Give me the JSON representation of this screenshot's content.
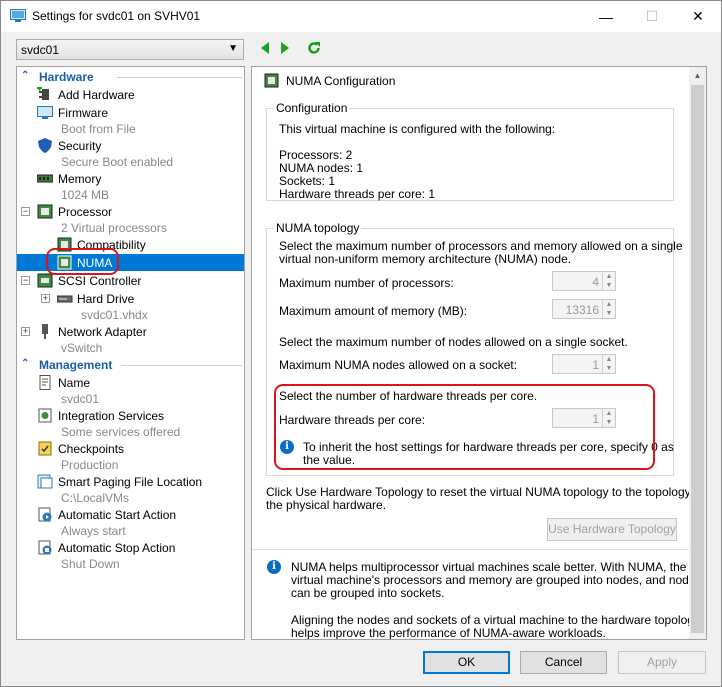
{
  "window": {
    "title": "Settings for svdc01 on SVHV01",
    "minimize": "—",
    "maximize": "☐",
    "close": "✕"
  },
  "vm_selector": {
    "value": "svdc01"
  },
  "tree": {
    "hardware_header": "Hardware",
    "management_header": "Management",
    "items": [
      {
        "label": "Add Hardware",
        "sub": ""
      },
      {
        "label": "Firmware",
        "sub": "Boot from File"
      },
      {
        "label": "Security",
        "sub": "Secure Boot enabled"
      },
      {
        "label": "Memory",
        "sub": "1024 MB"
      },
      {
        "label": "Processor",
        "sub": "2 Virtual processors"
      },
      {
        "label": "Compatibility",
        "sub": ""
      },
      {
        "label": "NUMA",
        "sub": ""
      },
      {
        "label": "SCSI Controller",
        "sub": ""
      },
      {
        "label": "Hard Drive",
        "sub": "svdc01.vhdx"
      },
      {
        "label": "Network Adapter",
        "sub": "vSwitch"
      },
      {
        "label": "Name",
        "sub": "svdc01"
      },
      {
        "label": "Integration Services",
        "sub": "Some services offered"
      },
      {
        "label": "Checkpoints",
        "sub": "Production"
      },
      {
        "label": "Smart Paging File Location",
        "sub": "C:\\LocalVMs"
      },
      {
        "label": "Automatic Start Action",
        "sub": "Always start"
      },
      {
        "label": "Automatic Stop Action",
        "sub": "Shut Down"
      }
    ]
  },
  "numa_panel": {
    "title": "NUMA Configuration",
    "config_group_title": "Configuration",
    "config_intro": "This virtual machine is configured with the following:",
    "config_lines": [
      "Processors: 2",
      "NUMA nodes: 1",
      "Sockets: 1",
      "Hardware threads per core: 1"
    ],
    "topology_group_title": "NUMA topology",
    "topology_desc_1": "Select the maximum number of processors and memory allowed on a single",
    "topology_desc_2": "virtual non-uniform memory architecture (NUMA) node.",
    "max_processors_label": "Maximum number of processors:",
    "max_processors_value": "4",
    "max_memory_label": "Maximum amount of memory (MB):",
    "max_memory_value": "13316",
    "nodes_desc": "Select the maximum number of nodes allowed on a single socket.",
    "max_nodes_label": "Maximum NUMA nodes allowed on a socket:",
    "max_nodes_value": "1",
    "threads_desc": "Select the number of hardware threads per core.",
    "threads_label": "Hardware threads per core:",
    "threads_value": "1",
    "threads_info_1": "To inherit the host settings for hardware threads per core, specify 0 as",
    "threads_info_2": "the value.",
    "reset_desc_1": "Click Use Hardware Topology to reset the virtual NUMA topology to the topology of",
    "reset_desc_2": "the physical hardware.",
    "use_hw_topology_button": "Use Hardware Topology",
    "info_1": "NUMA helps multiprocessor virtual machines scale better.  With NUMA, the",
    "info_2": "virtual machine's processors and memory are grouped into nodes, and nodes",
    "info_3": "can be grouped into sockets.",
    "info_4": "Aligning the nodes and sockets of a virtual machine to the hardware topology",
    "info_5": "helps improve the performance of NUMA-aware workloads."
  },
  "footer": {
    "ok": "OK",
    "cancel": "Cancel",
    "apply": "Apply"
  },
  "colors": {
    "accent": "#0078d7",
    "header_blue": "#1a5fa8",
    "highlight_red": "#d9141c"
  }
}
